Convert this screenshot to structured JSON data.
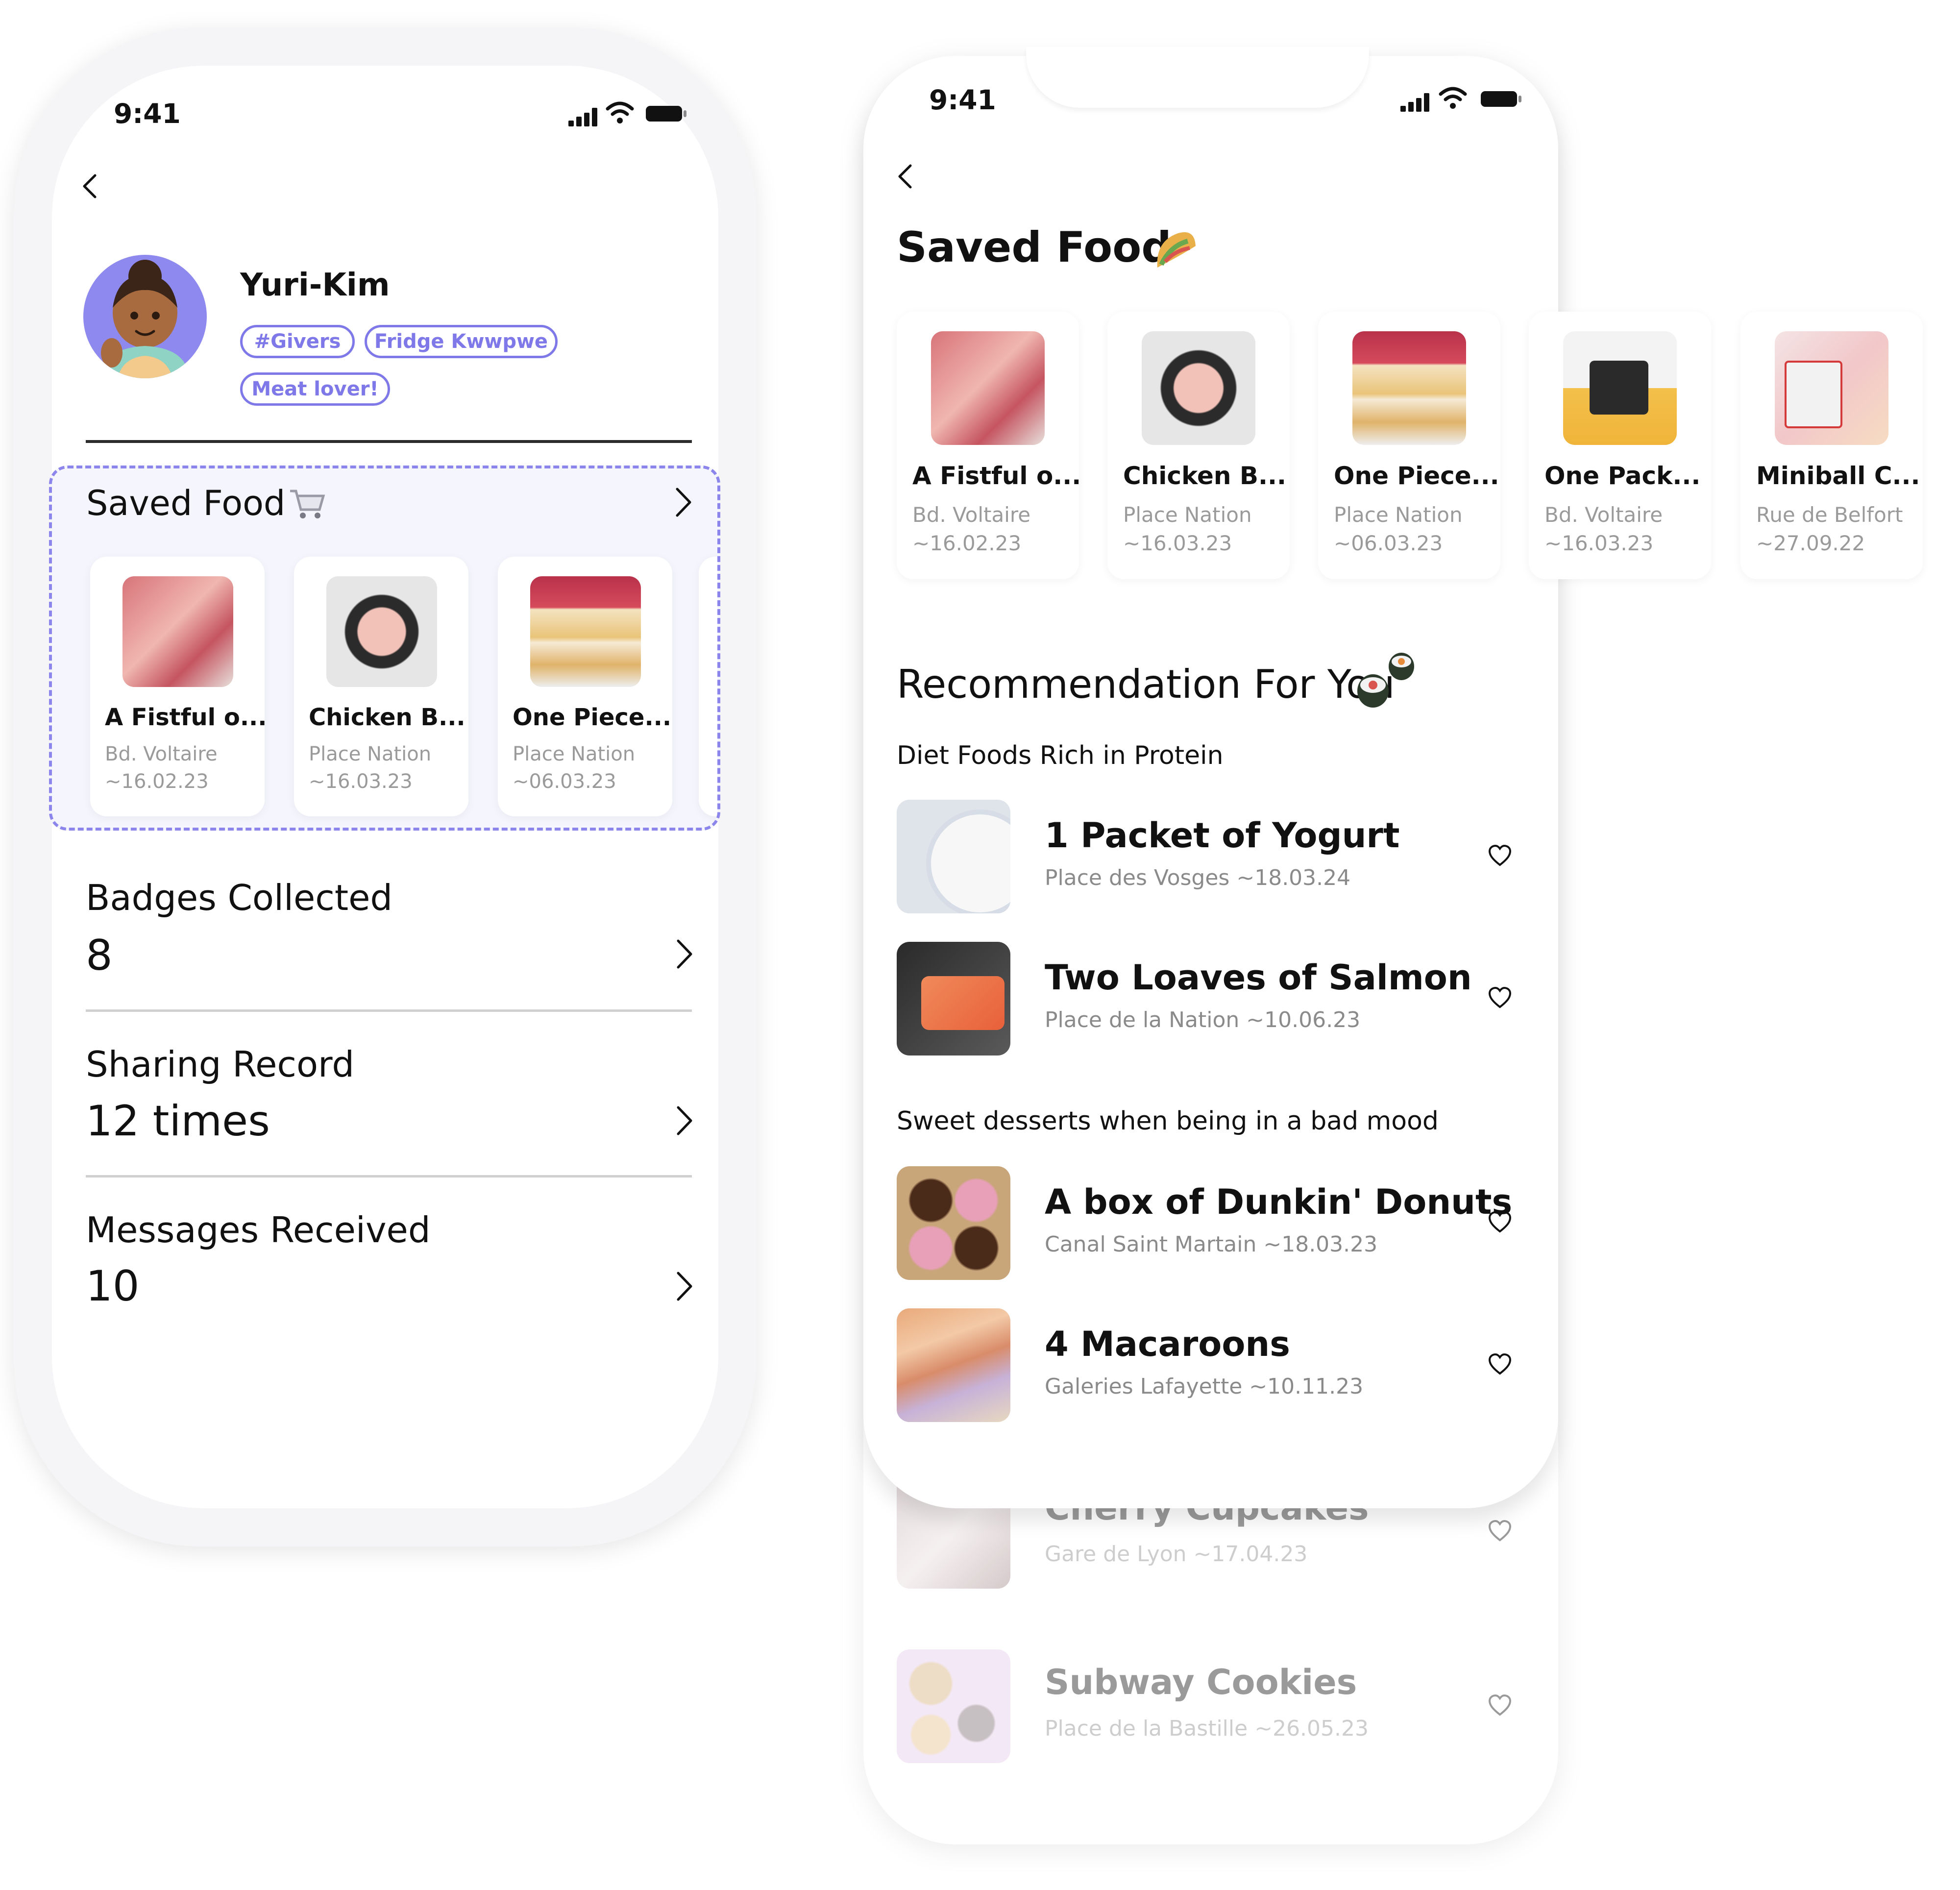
{
  "colors": {
    "accent": "#7e78e8",
    "saved_bg": "#f5f5fd",
    "text": "#111111",
    "muted": "#9a9a9a"
  },
  "left_phone": {
    "status": {
      "time": "9:41"
    },
    "profile": {
      "name": "Yuri-Kim",
      "tags": [
        "#Givers",
        "Fridge Kwwpwe",
        "Meat lover!"
      ]
    },
    "saved_food": {
      "title": "Saved Food",
      "icon": "shopping-cart-icon",
      "items": [
        {
          "title": "A Fistful o...",
          "place": "Bd. Voltaire",
          "date": "~16.02.23"
        },
        {
          "title": "Chicken B...",
          "place": "Place Nation",
          "date": "~16.03.23"
        },
        {
          "title": "One Piece...",
          "place": "Place Nation",
          "date": "~06.03.23"
        }
      ]
    },
    "stats": [
      {
        "label": "Badges Collected",
        "value": "8"
      },
      {
        "label": "Sharing Record",
        "value": "12 times"
      },
      {
        "label": "Messages Received",
        "value": "10"
      }
    ]
  },
  "right_phone": {
    "status": {
      "time": "9:41"
    },
    "title": "Saved Food",
    "title_icon": "taco-icon",
    "saved_items": [
      {
        "title": "A Fistful o...",
        "place": "Bd. Voltaire",
        "date": "~16.02.23"
      },
      {
        "title": "Chicken B...",
        "place": "Place Nation",
        "date": "~16.03.23"
      },
      {
        "title": "One Piece...",
        "place": "Place Nation",
        "date": "~06.03.23"
      },
      {
        "title": "One Pack...",
        "place": "Bd. Voltaire",
        "date": "~16.03.23"
      },
      {
        "title": "Miniball C...",
        "place": "Rue de Belfort",
        "date": "~27.09.22"
      }
    ],
    "recommendation": {
      "title": "Recommendation For You",
      "icon": "sushi-icon",
      "groups": [
        {
          "heading": "Diet Foods Rich in Protein",
          "items": [
            {
              "title": "1 Packet of Yogurt",
              "place": "Place des Vosges",
              "date": "~18.03.24"
            },
            {
              "title": "Two Loaves of Salmon",
              "place": "Place de la Nation",
              "date": "~10.06.23"
            }
          ]
        },
        {
          "heading": "Sweet desserts when being in a bad mood",
          "items": [
            {
              "title": "A box of Dunkin' Donuts",
              "place": "Canal Saint Martain",
              "date": "~18.03.23"
            },
            {
              "title": "4 Macaroons",
              "place": "Galeries Lafayette",
              "date": "~10.11.23"
            }
          ]
        }
      ],
      "faded_items": [
        {
          "title": "Cherry Cupcakes",
          "place": "Gare de Lyon",
          "date": "~17.04.23"
        },
        {
          "title": "Subway Cookies",
          "place": "Place de la Bastille",
          "date": "~26.05.23"
        }
      ]
    }
  }
}
